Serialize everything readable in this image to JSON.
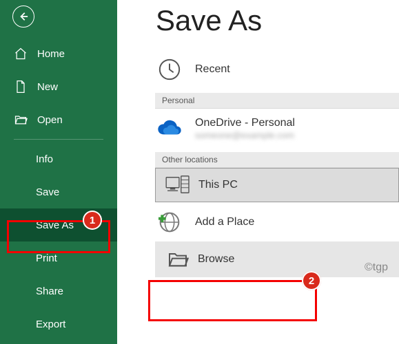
{
  "sidebar": {
    "items": [
      {
        "label": "Home"
      },
      {
        "label": "New"
      },
      {
        "label": "Open"
      },
      {
        "label": "Info"
      },
      {
        "label": "Save"
      },
      {
        "label": "Save As"
      },
      {
        "label": "Print"
      },
      {
        "label": "Share"
      },
      {
        "label": "Export"
      }
    ]
  },
  "main": {
    "title": "Save As",
    "recent_label": "Recent",
    "section_personal": "Personal",
    "onedrive_label": "OneDrive - Personal",
    "onedrive_account": "someone@example.com",
    "section_other": "Other locations",
    "this_pc_label": "This PC",
    "add_place_label": "Add a Place",
    "browse_label": "Browse"
  },
  "annotations": {
    "badge1": "1",
    "badge2": "2",
    "watermark": "©tgp"
  }
}
